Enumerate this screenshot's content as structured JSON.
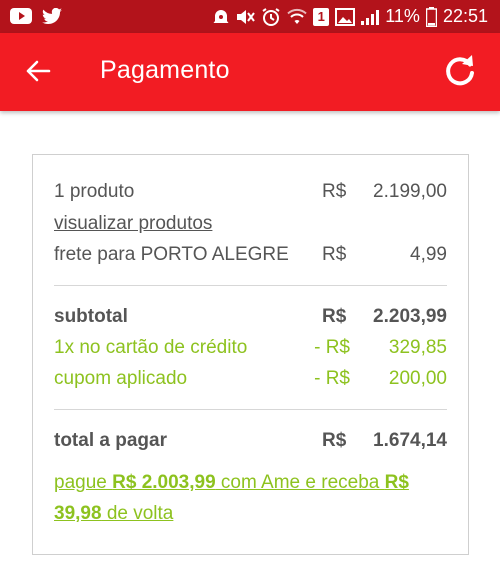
{
  "status_bar": {
    "battery_percent": "11%",
    "time": "22:51",
    "notification_badge": "1"
  },
  "app_bar": {
    "title": "Pagamento"
  },
  "summary": {
    "products": {
      "label": "1 produto",
      "currency": "R$",
      "value": "2.199,00"
    },
    "view_products_link": "visualizar produtos",
    "shipping": {
      "label": "frete para PORTO ALEGRE",
      "currency": "R$",
      "value": "4,99"
    },
    "subtotal": {
      "label": "subtotal",
      "currency": "R$",
      "value": "2.203,99"
    },
    "credit_card": {
      "label": "1x no cartão de crédito",
      "currency": "- R$",
      "value": "329,85"
    },
    "coupon": {
      "label": "cupom aplicado",
      "currency": "- R$",
      "value": "200,00"
    },
    "total": {
      "label": "total a pagar",
      "currency": "R$",
      "value": "1.674,14"
    },
    "ame_offer": {
      "part1": "pague ",
      "amount_pay": "R$ 2.003,99",
      "part2": " com Ame e receba ",
      "amount_back": "R$ 39,98",
      "part3": " de volta"
    }
  },
  "colors": {
    "status_bar": "#b3131b",
    "app_bar": "#f21c23",
    "green_text": "#8dc21f",
    "text": "#555555"
  }
}
